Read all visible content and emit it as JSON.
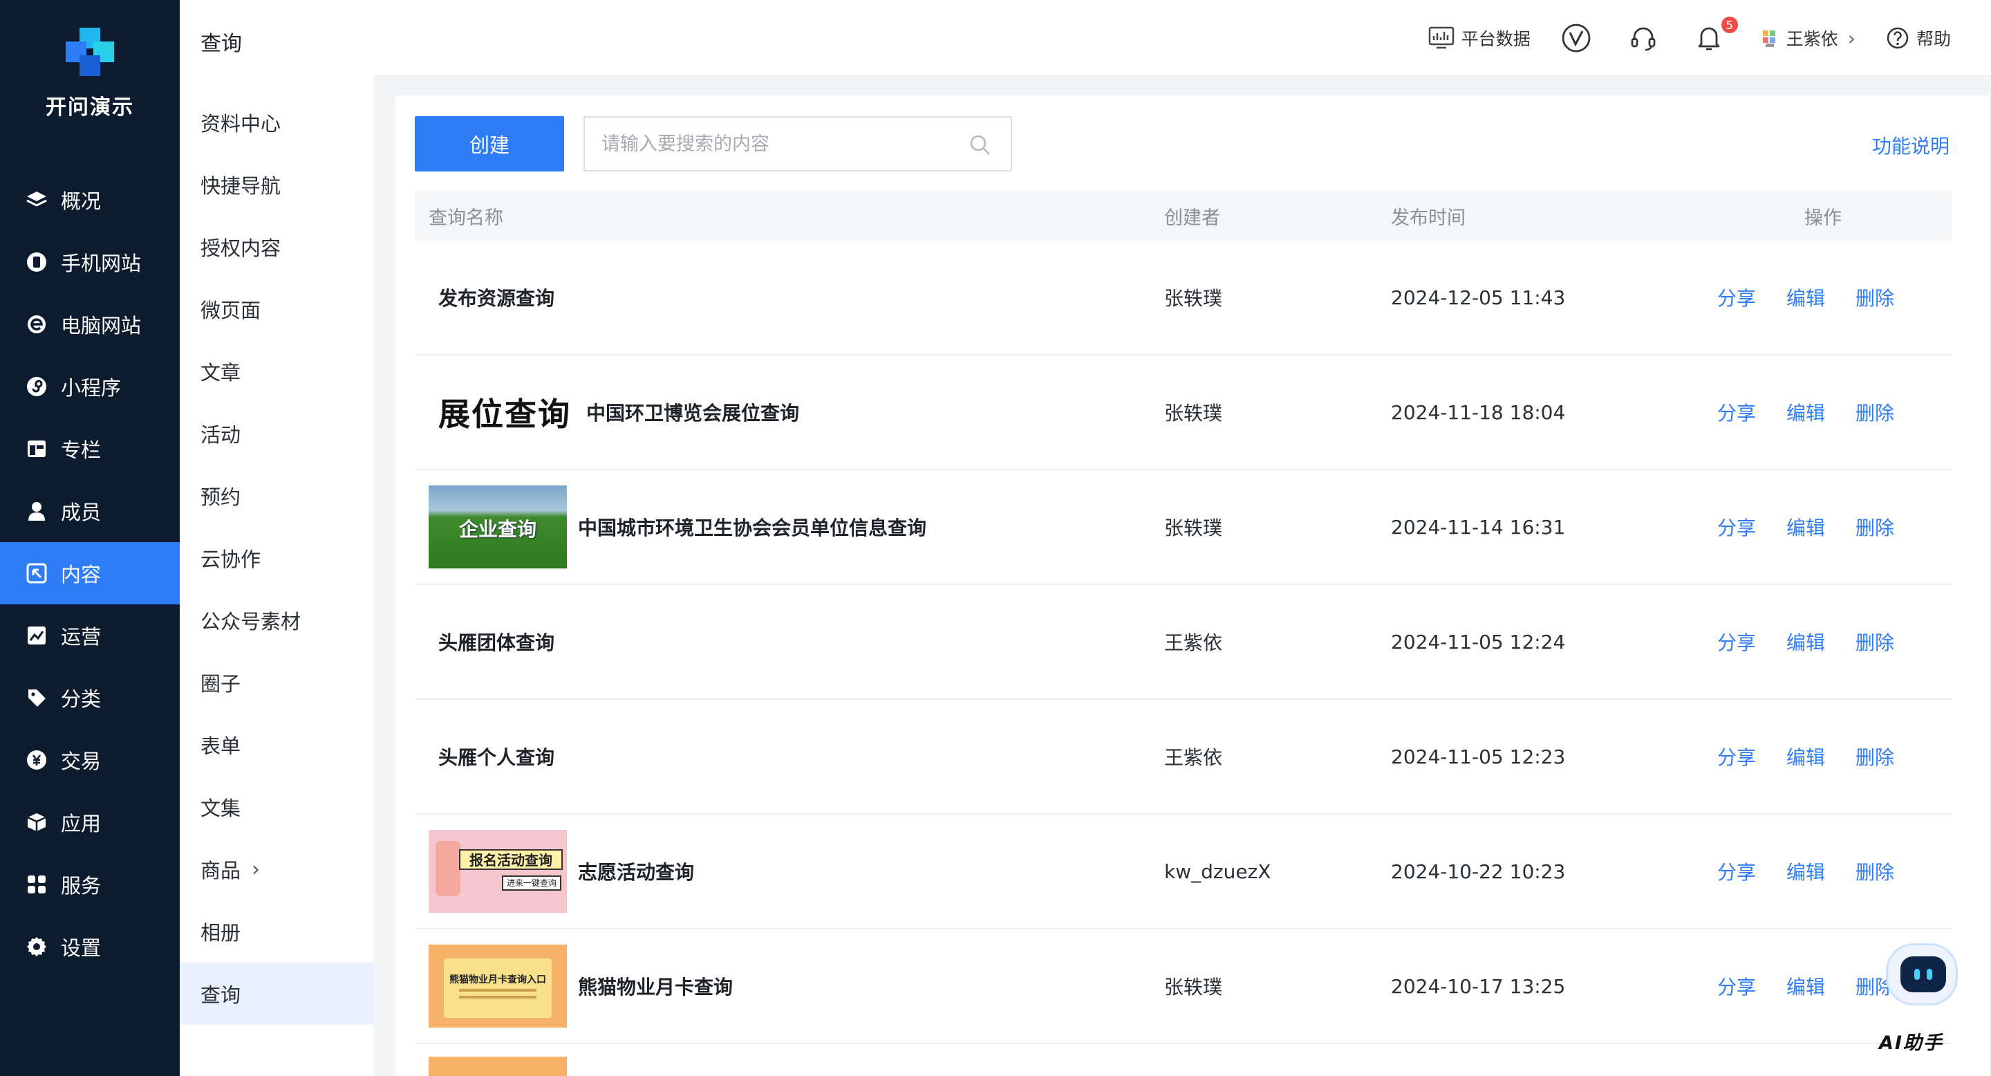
{
  "brand": {
    "name": "开问演示"
  },
  "nav": [
    {
      "label": "概况",
      "icon": "layers-icon"
    },
    {
      "label": "手机网站",
      "icon": "mobile-site-icon"
    },
    {
      "label": "电脑网站",
      "icon": "browser-e-icon"
    },
    {
      "label": "小程序",
      "icon": "mini-program-icon"
    },
    {
      "label": "专栏",
      "icon": "column-icon"
    },
    {
      "label": "成员",
      "icon": "member-icon"
    },
    {
      "label": "内容",
      "icon": "content-icon"
    },
    {
      "label": "运营",
      "icon": "operations-chart-icon"
    },
    {
      "label": "分类",
      "icon": "tag-icon"
    },
    {
      "label": "交易",
      "icon": "yuan-icon"
    },
    {
      "label": "应用",
      "icon": "cube-icon"
    },
    {
      "label": "服务",
      "icon": "grid-icon"
    },
    {
      "label": "设置",
      "icon": "gear-icon"
    }
  ],
  "nav_active": "内容",
  "subnav": {
    "title": "查询",
    "items": [
      {
        "label": "资料中心"
      },
      {
        "label": "快捷导航"
      },
      {
        "label": "授权内容"
      },
      {
        "label": "微页面"
      },
      {
        "label": "文章"
      },
      {
        "label": "活动"
      },
      {
        "label": "预约"
      },
      {
        "label": "云协作"
      },
      {
        "label": "公众号素材"
      },
      {
        "label": "圈子"
      },
      {
        "label": "表单"
      },
      {
        "label": "文集"
      },
      {
        "label": "商品"
      },
      {
        "label": "相册"
      },
      {
        "label": "查询"
      }
    ],
    "active": "查询"
  },
  "topbar": {
    "platform_data": "平台数据",
    "notifications_count": "5",
    "user_name": "王紫依",
    "help": "帮助"
  },
  "toolbar": {
    "create_label": "创建",
    "search_placeholder": "请输入要搜索的内容",
    "search_value": "",
    "feature_help": "功能说明"
  },
  "table": {
    "headers": {
      "name": "查询名称",
      "creator": "创建者",
      "time": "发布时间",
      "ops": "操作"
    },
    "op_labels": {
      "share": "分享",
      "edit": "编辑",
      "delete": "删除"
    },
    "rows": [
      {
        "name": "发布资源查询",
        "creator": "张轶璞",
        "time": "2024-12-05 11:43",
        "thumb": ""
      },
      {
        "name": "中国环卫博览会展位查询",
        "label": "展位查询",
        "creator": "张轶璞",
        "time": "2024-11-18 18:04",
        "thumb": ""
      },
      {
        "name": "中国城市环境卫生协会会员单位信息查询",
        "creator": "张轶璞",
        "time": "2024-11-14 16:31",
        "thumb": "green-field",
        "thumb_text": "企业查询"
      },
      {
        "name": "头雁团体查询",
        "creator": "王紫依",
        "time": "2024-11-05 12:24",
        "thumb": ""
      },
      {
        "name": "头雁个人查询",
        "creator": "王紫依",
        "time": "2024-11-05 12:23",
        "thumb": ""
      },
      {
        "name": "志愿活动查询",
        "creator": "kw_dzuezX",
        "time": "2024-10-22 10:23",
        "thumb": "pink-banner",
        "thumb_text": "报名活动查询",
        "thumb_sub": "进来一键查询"
      },
      {
        "name": "熊猫物业月卡查询",
        "creator": "张轶璞",
        "time": "2024-10-17 13:25",
        "thumb": "orange-folder",
        "thumb_text": "熊猫物业月卡查询入口"
      }
    ]
  },
  "ai_helper": {
    "label": "AI助手"
  },
  "colors": {
    "sidebar_bg": "#0d1b2e",
    "accent": "#2f7df6",
    "badge": "#f04b4b"
  }
}
